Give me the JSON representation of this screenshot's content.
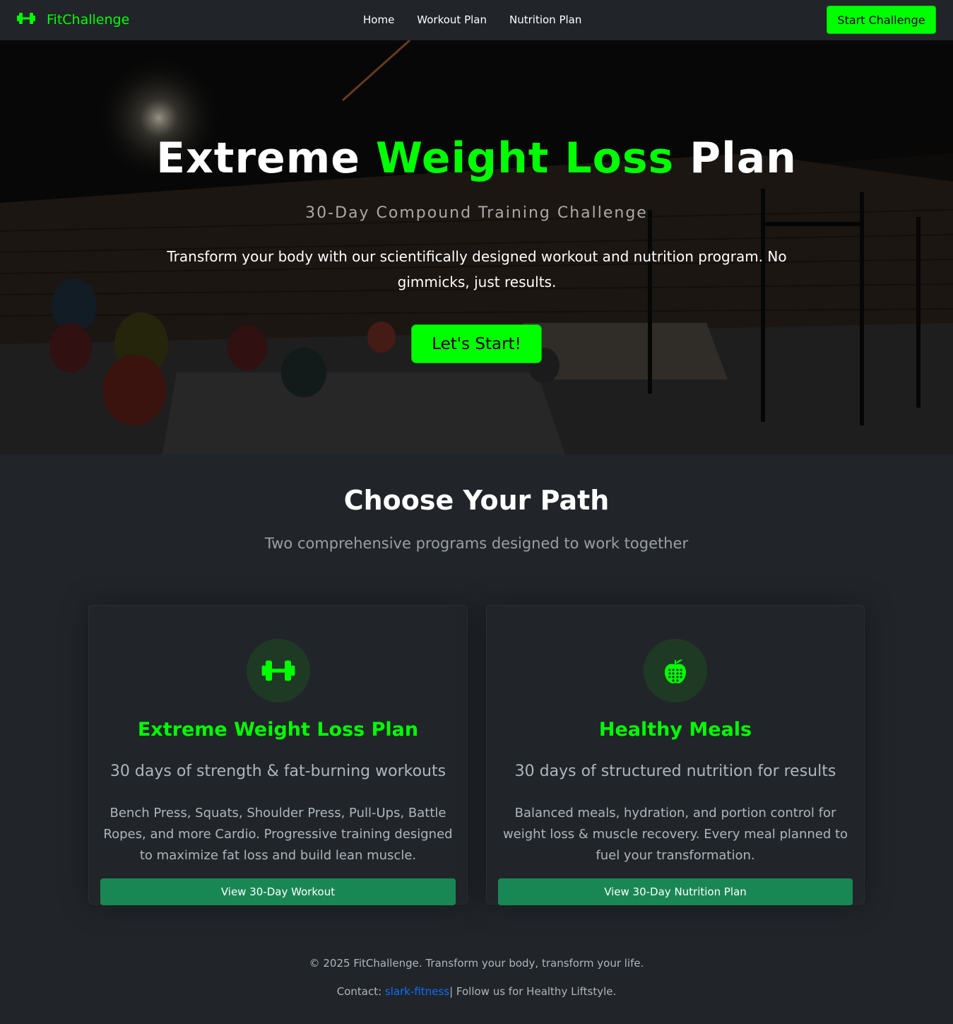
{
  "nav": {
    "brand": "FitChallenge",
    "brand_icon": "dumbbell-icon",
    "links": [
      "Home",
      "Workout Plan",
      "Nutrition Plan"
    ],
    "cta": "Start Challenge"
  },
  "hero": {
    "title_part1": "Extreme ",
    "title_accent": "Weight Loss",
    "title_part2": " Plan",
    "subtitle": "30-Day Compound Training Challenge",
    "description": "Transform your body with our scientifically designed workout and nutrition program. No gimmicks, just results.",
    "button": "Let's Start!"
  },
  "paths": {
    "title": "Choose Your Path",
    "subtitle": "Two comprehensive programs designed to work together",
    "cards": [
      {
        "icon": "dumbbell-icon",
        "title": "Extreme Weight Loss Plan",
        "tagline": "30 days of strength & fat-burning workouts",
        "body": "Bench Press, Squats, Shoulder Press, Pull-Ups, Battle Ropes, and more Cardio. Progressive training designed to maximize fat loss and build lean muscle.",
        "button": "View 30-Day Workout"
      },
      {
        "icon": "apple-icon",
        "title": "Healthy Meals",
        "tagline": "30 days of structured nutrition for results",
        "body": "Balanced meals, hydration, and portion control for weight loss & muscle recovery. Every meal planned to fuel your transformation.",
        "button": "View 30-Day Nutrition Plan"
      }
    ]
  },
  "footer": {
    "copyright": "© 2025 FitChallenge. Transform your body, transform your life.",
    "contact_label": "Contact: ",
    "contact_link": "slark-fitness",
    "follow": "| Follow us for Healthy Liftstyle."
  },
  "colors": {
    "accent": "#00ff00",
    "background": "#212529",
    "button_green": "#198754",
    "link": "#0d6efd"
  }
}
